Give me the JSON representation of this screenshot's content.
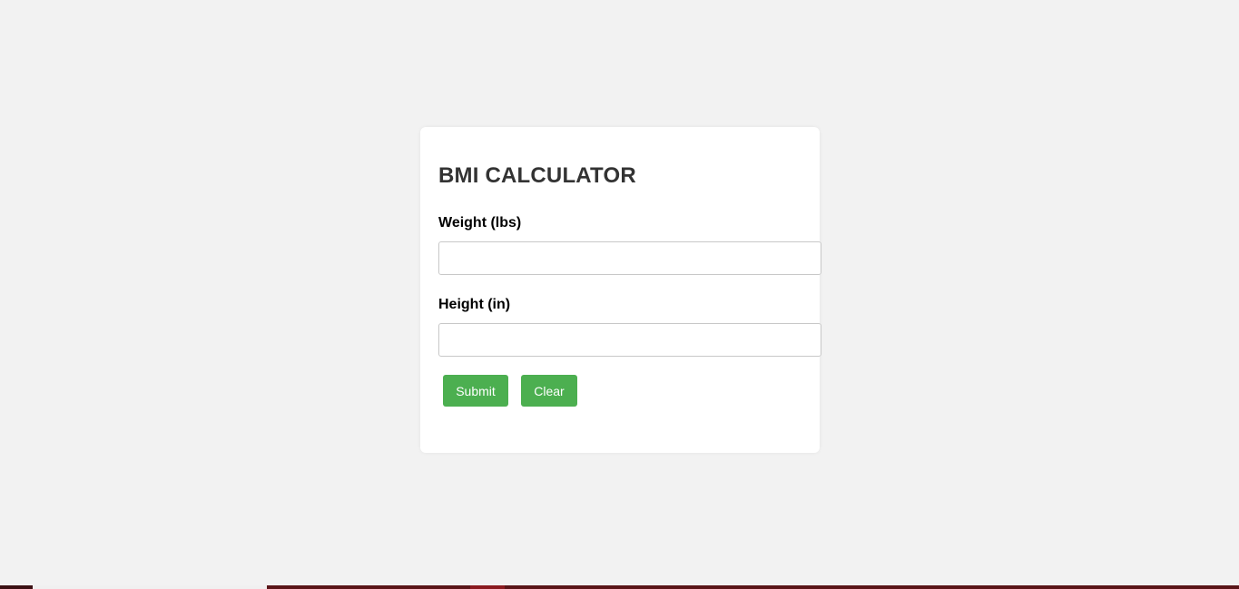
{
  "form": {
    "title": "BMI CALCULATOR",
    "weight_label": "Weight (lbs)",
    "weight_value": "",
    "height_label": "Height (in)",
    "height_value": "",
    "submit_label": "Submit",
    "clear_label": "Clear"
  },
  "colors": {
    "page_background": "#f2f2f2",
    "card_background": "#ffffff",
    "title_text": "#333333",
    "button_background": "#4caf50",
    "button_text": "#ffffff",
    "taskbar": "#5a1518"
  }
}
